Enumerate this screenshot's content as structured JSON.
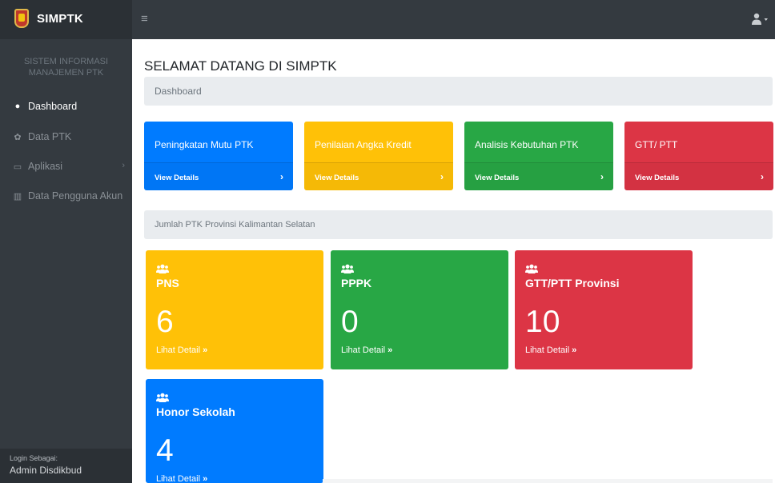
{
  "colors": {
    "primary": "#007bff",
    "warning": "#ffc107",
    "success": "#28a745",
    "danger": "#dc3545",
    "sidebar": "#343a40",
    "topbar": "#343a40"
  },
  "header": {
    "brand_name": "SIMPTK",
    "logo_icon": "provincial-logo-icon",
    "toggle_icon": "hamburger-icon",
    "toggle_glyph": "≡",
    "user_icon": "user-icon"
  },
  "sidebar": {
    "heading": "SISTEM INFORMASI\nMANAJEMEN PTK",
    "items": [
      {
        "label": "Dashboard",
        "icon": "dashboard-icon",
        "glyph": "●",
        "active": true
      },
      {
        "label": "Data PTK",
        "icon": "users-icon",
        "glyph": "✿",
        "active": false
      },
      {
        "label": "Aplikasi",
        "icon": "laptop-icon",
        "glyph": "▭",
        "active": false
      },
      {
        "label": "Data Pengguna Akun",
        "icon": "chart-icon",
        "glyph": "▥",
        "active": false
      }
    ],
    "chevron_glyph": "›",
    "footer": {
      "label": "Login Sebagai:",
      "name": "Admin Disdikbud"
    }
  },
  "main": {
    "page_title": "SELAMAT DATANG DI SIMPTK",
    "breadcrumb": "Dashboard",
    "cards": [
      {
        "title": "Peningkatan Mutu PTK",
        "link": "View Details",
        "arrow": "›",
        "color": "blue"
      },
      {
        "title": "Penilaian Angka Kredit",
        "link": "View Details",
        "arrow": "›",
        "color": "yellow"
      },
      {
        "title": "Analisis Kebutuhan PTK",
        "link": "View Details",
        "arrow": "›",
        "color": "green"
      },
      {
        "title": "GTT/ PTT",
        "link": "View Details",
        "arrow": "›",
        "color": "red"
      }
    ],
    "info_label": "Jumlah PTK Provinsi Kalimantan Selatan",
    "stats": [
      {
        "title": "PNS",
        "value": "6",
        "link": "Lihat Detail",
        "link_icon": "»",
        "icon": "users-icon",
        "color": "yellow"
      },
      {
        "title": "PPPK",
        "value": "0",
        "link": "Lihat Detail",
        "link_icon": "»",
        "icon": "users-icon",
        "color": "green"
      },
      {
        "title": "GTT/PTT Provinsi",
        "value": "10",
        "link": "Lihat Detail",
        "link_icon": "»",
        "icon": "users-icon",
        "color": "red"
      },
      {
        "title": "Honor Sekolah",
        "value": "4",
        "link": "Lihat Detail",
        "link_icon": "»",
        "icon": "users-icon",
        "color": "blue"
      }
    ]
  }
}
